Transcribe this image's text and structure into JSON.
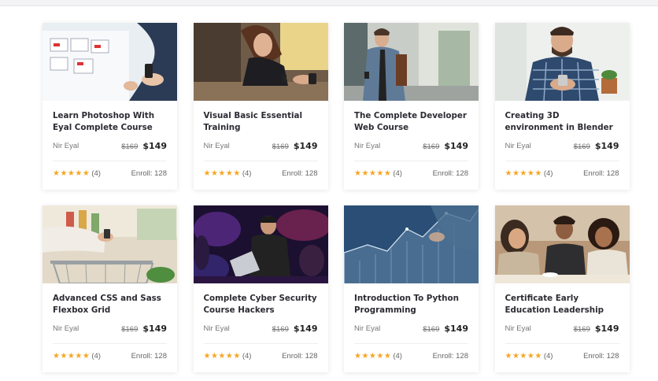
{
  "courses": [
    {
      "title": "Learn Photoshop With Eyal Complete Course",
      "instructor": "Nir Eyal",
      "old_price": "$169",
      "price": "$149",
      "stars": "★★★★★",
      "rating_count": "(4)",
      "enroll": "Enroll: 128",
      "image": "photoshop-ui-sketches-photo"
    },
    {
      "title": "Visual Basic Essential Training",
      "instructor": "Nir Eyal",
      "old_price": "$169",
      "price": "$149",
      "stars": "★★★★★",
      "rating_count": "(4)",
      "enroll": "Enroll: 128",
      "image": "woman-using-phone-photo"
    },
    {
      "title": "The Complete Developer Web Course",
      "instructor": "Nir Eyal",
      "old_price": "$169",
      "price": "$149",
      "stars": "★★★★★",
      "rating_count": "(4)",
      "enroll": "Enroll: 128",
      "image": "man-walking-with-phone-photo"
    },
    {
      "title": "Creating 3D environment in Blender",
      "instructor": "Nir Eyal",
      "old_price": "$169",
      "price": "$149",
      "stars": "★★★★★",
      "rating_count": "(4)",
      "enroll": "Enroll: 128",
      "image": "smiling-man-with-phone-photo"
    },
    {
      "title": "Advanced CSS and Sass Flexbox Grid",
      "instructor": "Nir Eyal",
      "old_price": "$169",
      "price": "$149",
      "stars": "★★★★★",
      "rating_count": "(4)",
      "enroll": "Enroll: 128",
      "image": "shopping-cart-phone-photo"
    },
    {
      "title": "Complete Cyber Security Course Hackers",
      "instructor": "Nir Eyal",
      "old_price": "$169",
      "price": "$149",
      "stars": "★★★★★",
      "rating_count": "(4)",
      "enroll": "Enroll: 128",
      "image": "hackers-with-laptops-photo"
    },
    {
      "title": "Introduction To Python Programming",
      "instructor": "Nir Eyal",
      "old_price": "$169",
      "price": "$149",
      "stars": "★★★★★",
      "rating_count": "(4)",
      "enroll": "Enroll: 128",
      "image": "data-chart-hologram-photo"
    },
    {
      "title": "Certificate Early Education Leadership",
      "instructor": "Nir Eyal",
      "old_price": "$169",
      "price": "$149",
      "stars": "★★★★★",
      "rating_count": "(4)",
      "enroll": "Enroll: 128",
      "image": "friends-at-cafe-photo"
    }
  ],
  "colors": {
    "star": "#f6a623",
    "title": "#2b2b33",
    "meta": "#777777"
  }
}
